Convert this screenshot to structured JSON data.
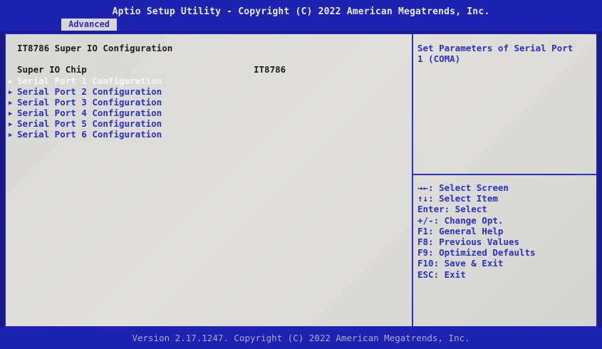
{
  "header": {
    "title": "Aptio Setup Utility - Copyright (C) 2022 American Megatrends, Inc.",
    "tabs": [
      {
        "label": "Advanced",
        "active": true
      }
    ]
  },
  "main": {
    "section_title": "IT8786 Super IO Configuration",
    "chip": {
      "label": "Super IO Chip",
      "value": "IT8786"
    },
    "items": [
      {
        "label": "Serial Port 1 Configuration",
        "selected": true
      },
      {
        "label": "Serial Port 2 Configuration",
        "selected": false
      },
      {
        "label": "Serial Port 3 Configuration",
        "selected": false
      },
      {
        "label": "Serial Port 4 Configuration",
        "selected": false
      },
      {
        "label": "Serial Port 5 Configuration",
        "selected": false
      },
      {
        "label": "Serial Port 6 Configuration",
        "selected": false
      }
    ]
  },
  "help": {
    "description": "Set Parameters of Serial Port\n1 (COMA)",
    "keys": [
      "→←: Select Screen",
      "↑↓: Select Item",
      "Enter: Select",
      "+/-: Change Opt.",
      "F1: General Help",
      "F8: Previous Values",
      "F9: Optimized Defaults",
      "F10: Save & Exit",
      "ESC: Exit"
    ]
  },
  "footer": {
    "version": "Version 2.17.1247. Copyright (C) 2022 American Megatrends, Inc."
  },
  "colors": {
    "header_bg": "#1e22b0",
    "panel_bg": "#d7d7d5",
    "accent_text": "#2a30c8",
    "selected_text": "#f5f5f5"
  }
}
